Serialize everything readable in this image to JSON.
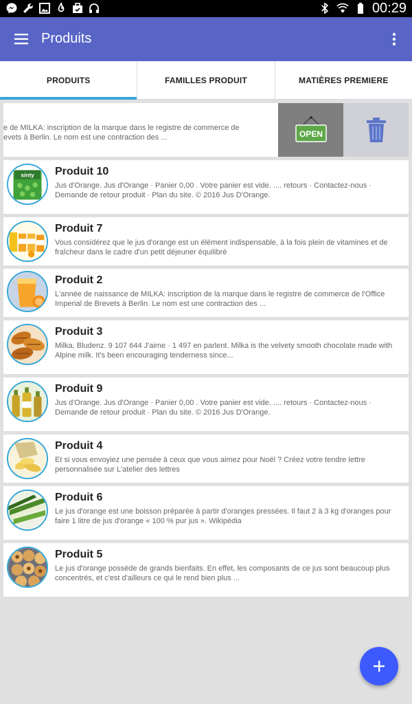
{
  "status_bar": {
    "time": "00:29",
    "left_icons": [
      "messenger-icon",
      "wrench-icon",
      "image-icon",
      "flame-icon",
      "briefcase-icon",
      "headphones-icon"
    ],
    "right_icons": [
      "bluetooth-icon",
      "wifi-icon",
      "battery-icon"
    ]
  },
  "app_bar": {
    "title": "Produits",
    "background": "#5865c7"
  },
  "tabs": [
    {
      "label": "PRODUITS",
      "active": true
    },
    {
      "label": "FAMILLES PRODUIT",
      "active": false
    },
    {
      "label": "MATIÈRES PREMIERE",
      "active": false
    }
  ],
  "swiped_item": {
    "description": "e de MILKA: inscription de la marque dans le registre de commerce de\nevets à Berlin. Le nom est une contraction des ...",
    "open_label": "OPEN"
  },
  "products": [
    {
      "name": "Produit 10",
      "description": "Jus d'Orange. Jus d'Orange · Panier 0,00  . Votre panier est vide. .... retours · Contactez-nous · Demande de retour produit · Plan du site. © 2016 Jus D'Orange.",
      "image": "green-candy-pack"
    },
    {
      "name": "Produit 7",
      "description": "Vous considérez que le jus d'orange est un élément indispensable, à la fois plein de vitamines et de fraîcheur dans le cadre d'un petit déjeuner équilibré",
      "image": "juice-bottles"
    },
    {
      "name": "Produit 2",
      "description": "L'année de naissance de MILKA: inscription de la marque dans le registre de commerce de l'Office Imperial de Brevets à Berlin. Le nom est une contraction des ...",
      "image": "orange-juice-glass"
    },
    {
      "name": "Produit 3",
      "description": "Milka, Bludenz. 9 107 644 J'aime · 1 497 en parlent. Milka is the velvety smooth chocolate made with Alpine milk. It's been encouraging tenderness since...",
      "image": "croissants"
    },
    {
      "name": "Produit 9",
      "description": "Jus d'Orange. Jus d'Orange · Panier 0,00  . Votre panier est vide. .... retours · Contactez-nous · Demande de retour produit · Plan du site. © 2016 Jus D'Orange.",
      "image": "oil-bottles"
    },
    {
      "name": "Produit 4",
      "description": "Et si vous envoyiez une pensée à ceux que vous aimez pour Noël ? Créez votre tendre lettre personnalisée sur L'atelier des lettres",
      "image": "chips"
    },
    {
      "name": "Produit 6",
      "description": "Le jus d'orange est une boisson préparée à partir d'oranges pressées. Il faut 2 à 3 kg d'oranges pour faire 1 litre de jus d'orange « 100 % pur jus ». Wikipédia",
      "image": "leeks"
    },
    {
      "name": "Produit 5",
      "description": "Le jus d'orange possède de grands bienfaits. En effet, les composants de ce jus sont beaucoup plus concentrés, et c'est d'ailleurs ce qui le rend bien plus ...",
      "image": "muffins"
    }
  ],
  "fab": {
    "icon": "plus-icon",
    "color": "#3d5afe"
  }
}
